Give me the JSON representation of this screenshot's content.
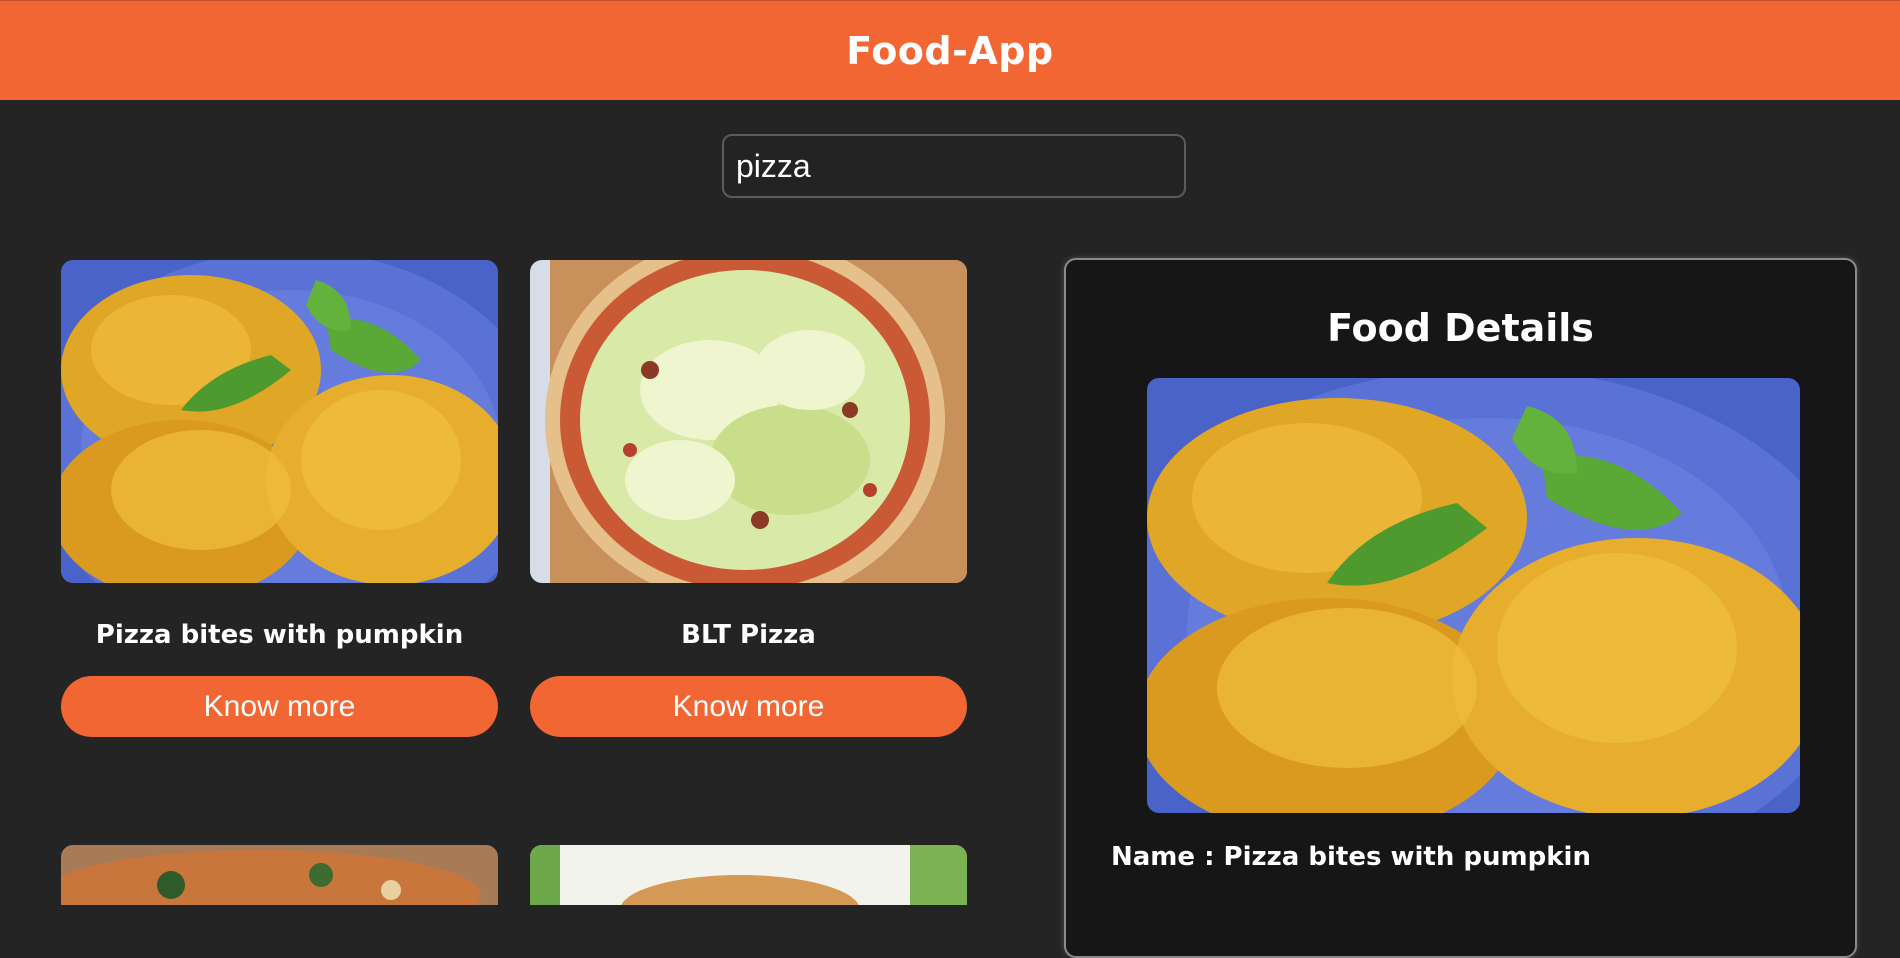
{
  "app": {
    "title": "Food-App"
  },
  "search": {
    "value": "pizza",
    "placeholder": ""
  },
  "cards": [
    {
      "title": "Pizza bites with pumpkin",
      "button_label": "Know more",
      "image": "pizza-bites-photo"
    },
    {
      "title": "BLT Pizza",
      "button_label": "Know more",
      "image": "blt-pizza-photo"
    },
    {
      "title": "",
      "button_label": "",
      "image": "pizza-photo-partial"
    },
    {
      "title": "",
      "button_label": "",
      "image": "pizza-photo-partial"
    }
  ],
  "details": {
    "heading": "Food Details",
    "name_label": "Name :",
    "name_value": "Pizza bites with pumpkin",
    "image": "pizza-bites-photo"
  },
  "colors": {
    "accent": "#f16633",
    "background": "#242424",
    "panel": "#161616"
  }
}
